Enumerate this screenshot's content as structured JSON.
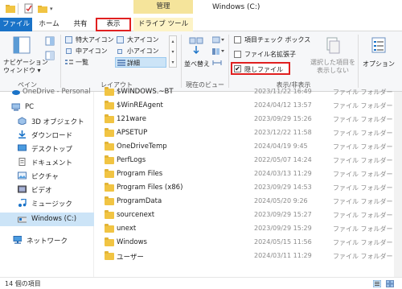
{
  "window": {
    "title": "Windows (C:)",
    "context_tab_label": "管理"
  },
  "tabs": [
    {
      "label": "ファイル"
    },
    {
      "label": "ホーム"
    },
    {
      "label": "共有"
    },
    {
      "label": "表示"
    },
    {
      "label": "ドライブ ツール"
    }
  ],
  "ribbon": {
    "pane": {
      "label_line1": "ナビゲーション",
      "label_line2": "ウィンドウ ▾",
      "group": "ペイン"
    },
    "layout": {
      "items": [
        "特大アイコン",
        "大アイコン",
        "中アイコン",
        "小アイコン",
        "一覧",
        "詳細"
      ],
      "selected": "詳細",
      "group": "レイアウト"
    },
    "current_view": {
      "sort_label": "並べ替え",
      "group": "現在のビュー"
    },
    "show_hide": {
      "item_checkboxes": "項目チェック ボックス",
      "file_ext": "ファイル名拡張子",
      "hidden_items": "隠しファイル",
      "hide_selected_line1": "選択した項目を",
      "hide_selected_line2": "表示しない",
      "group": "表示/非表示"
    },
    "options_label": "オプション"
  },
  "nav": {
    "truncated_top": "OneDrive - Personal",
    "items": [
      "PC",
      "3D オブジェクト",
      "ダウンロード",
      "デスクトップ",
      "ドキュメント",
      "ピクチャ",
      "ビデオ",
      "ミュージック",
      "Windows (C:)",
      "ネットワーク"
    ],
    "selected": "Windows (C:)"
  },
  "files": [
    {
      "name": "$WINDOWS.~BT",
      "date": "2023/11/22 16:49",
      "type": "ファイル フォルダー"
    },
    {
      "name": "$WinREAgent",
      "date": "2024/04/12 13:57",
      "type": "ファイル フォルダー"
    },
    {
      "name": "121ware",
      "date": "2023/09/29 15:26",
      "type": "ファイル フォルダー"
    },
    {
      "name": "APSETUP",
      "date": "2023/12/22 11:58",
      "type": "ファイル フォルダー"
    },
    {
      "name": "OneDriveTemp",
      "date": "2024/04/19 9:45",
      "type": "ファイル フォルダー"
    },
    {
      "name": "PerfLogs",
      "date": "2022/05/07 14:24",
      "type": "ファイル フォルダー"
    },
    {
      "name": "Program Files",
      "date": "2024/03/13 11:29",
      "type": "ファイル フォルダー"
    },
    {
      "name": "Program Files (x86)",
      "date": "2023/09/29 14:53",
      "type": "ファイル フォルダー"
    },
    {
      "name": "ProgramData",
      "date": "2024/05/20 9:26",
      "type": "ファイル フォルダー"
    },
    {
      "name": "sourcenext",
      "date": "2023/09/29 15:27",
      "type": "ファイル フォルダー"
    },
    {
      "name": "unext",
      "date": "2023/09/29 15:29",
      "type": "ファイル フォルダー"
    },
    {
      "name": "Windows",
      "date": "2024/05/15 11:56",
      "type": "ファイル フォルダー"
    },
    {
      "name": "ユーザー",
      "date": "2024/03/11 11:29",
      "type": "ファイル フォルダー"
    }
  ],
  "status": {
    "count": "14 個の項目"
  },
  "colors": {
    "accent": "#1a73c8",
    "highlight_box": "#e02020",
    "folder": "#f1c443",
    "selection": "#cce4f7"
  }
}
